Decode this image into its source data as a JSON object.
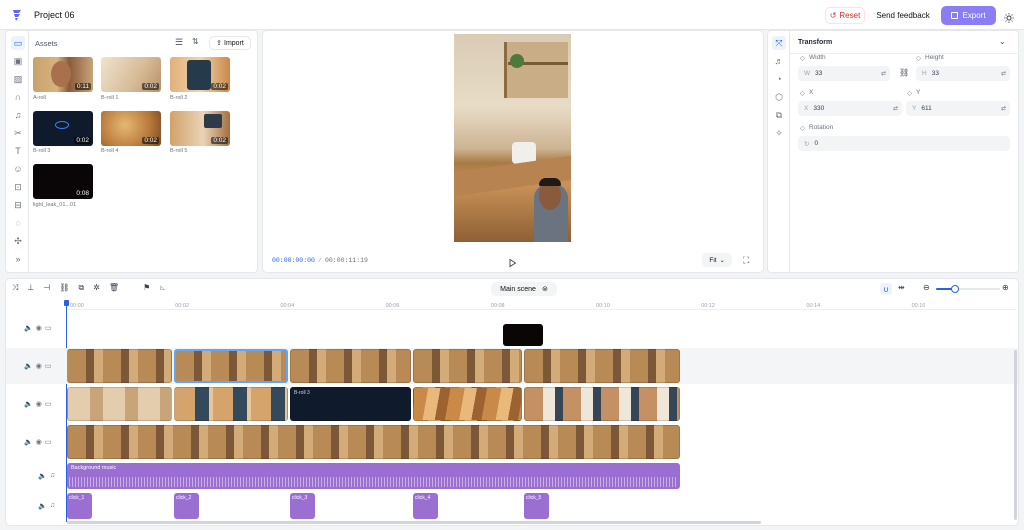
{
  "header": {
    "project_title": "Project 06",
    "reset_label": "Reset",
    "feedback_label": "Send feedback",
    "export_label": "Export"
  },
  "assets": {
    "title": "Assets",
    "import_label": "Import",
    "items": [
      {
        "name": "A-roll",
        "duration": "0:11"
      },
      {
        "name": "B-roll 1",
        "duration": "0:02"
      },
      {
        "name": "B-roll 2",
        "duration": "0:02"
      },
      {
        "name": "B-roll 3",
        "duration": "0:02"
      },
      {
        "name": "B-roll 4",
        "duration": "0:02"
      },
      {
        "name": "B-roll 5",
        "duration": "0:02"
      },
      {
        "name": "light_leak_01...01",
        "duration": "0:08"
      }
    ]
  },
  "preview": {
    "current_time": "00:00:00:00",
    "separator": "/",
    "total_time": "00:00:11:19",
    "fit_label": "Fit"
  },
  "properties": {
    "section_title": "Transform",
    "width_label": "Width",
    "height_label": "Height",
    "width_prefix": "W",
    "width_value": "33",
    "height_prefix": "H",
    "height_value": "33",
    "x_label": "X",
    "y_label": "Y",
    "x_prefix": "X",
    "x_value": "330",
    "y_prefix": "Y",
    "y_value": "611",
    "rotation_label": "Rotation",
    "rotation_value": "0"
  },
  "timeline": {
    "scene_label": "Main scene",
    "ticks": [
      "00:00",
      "00:02",
      "00:04",
      "00:06",
      "00:08",
      "00:10",
      "00:12",
      "00:14",
      "00:16"
    ],
    "zoom_level": 0.3,
    "broll3_label": "B-roll 3",
    "music_label": "Background music",
    "sfx_labels": [
      "click_1",
      "click_2",
      "click_3",
      "click_4",
      "click_5"
    ]
  },
  "colors": {
    "accent": "#7c6cf2",
    "audio": "#9b6fd1",
    "reset": "#dc2626",
    "timecode": "#2563eb"
  }
}
